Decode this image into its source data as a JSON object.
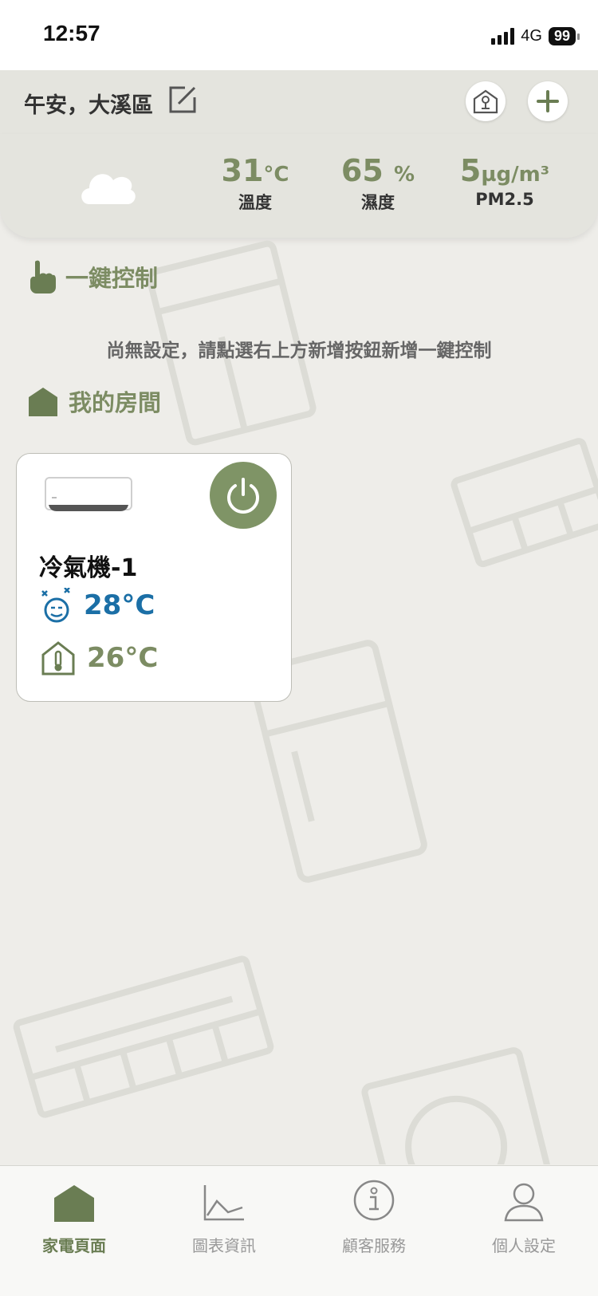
{
  "status_bar": {
    "time": "12:57",
    "network": "4G",
    "battery": "99"
  },
  "header": {
    "greeting": "午安，大溪區",
    "icons": [
      "edit-icon",
      "house-lock-icon",
      "plus-icon"
    ]
  },
  "weather": {
    "icon": "cloud-icon",
    "temperature": {
      "value": "31",
      "unit": "°C",
      "label": "溫度"
    },
    "humidity": {
      "value": "65",
      "unit": "%",
      "label": "濕度"
    },
    "pm25": {
      "value": "5",
      "unit": "µg/m³",
      "label": "PM2.5"
    }
  },
  "one_key": {
    "title": "一鍵控制",
    "empty_message": "尚無設定，請點選右上方新增按鈕新增一鍵控制"
  },
  "rooms": {
    "title": "我的房間",
    "devices": [
      {
        "name": "冷氣機-1",
        "set_temp": "28°C",
        "indoor_temp": "26°C",
        "power_on": true
      }
    ]
  },
  "tabs": [
    {
      "label": "家電頁面",
      "icon": "house-icon",
      "active": true
    },
    {
      "label": "圖表資訊",
      "icon": "chart-icon",
      "active": false
    },
    {
      "label": "顧客服務",
      "icon": "info-icon",
      "active": false
    },
    {
      "label": "個人設定",
      "icon": "person-icon",
      "active": false
    }
  ],
  "colors": {
    "accent": "#7c8c63",
    "set_temp": "#1b6fa6",
    "background": "#eeede9"
  }
}
